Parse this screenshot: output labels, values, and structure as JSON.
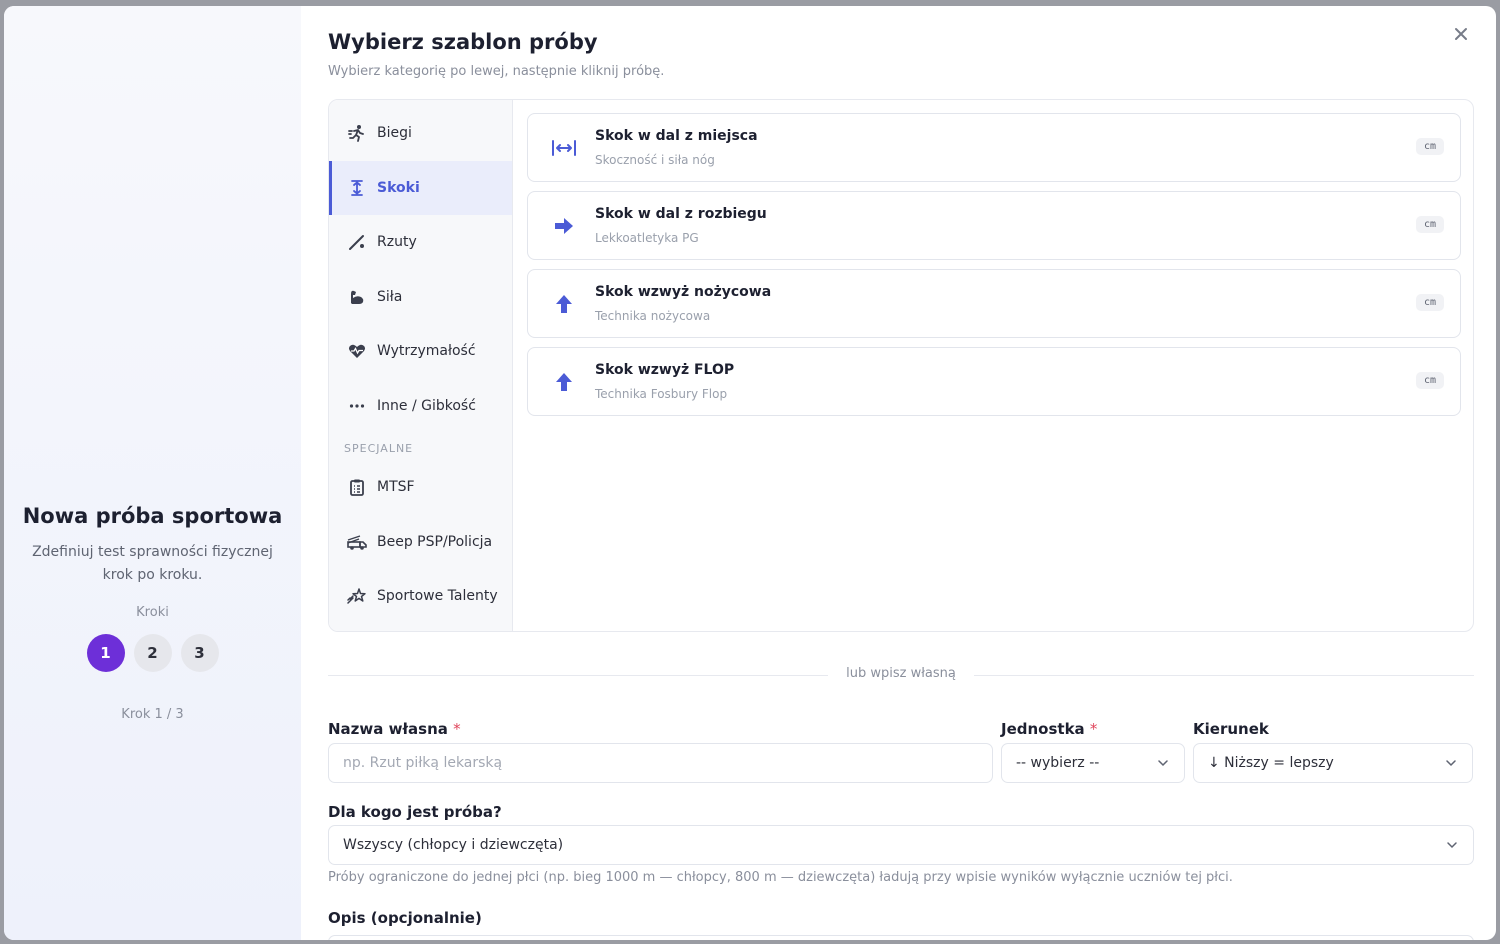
{
  "wizard": {
    "title": "Nowa próba sportowa",
    "subtitle": "Zdefiniuj test sprawności fizycznej krok po kroku.",
    "steps_label": "Kroki",
    "steps": [
      "1",
      "2",
      "3"
    ],
    "active_step": "1",
    "counter": "Krok 1 / 3"
  },
  "header": {
    "title": "Wybierz szablon próby",
    "subtitle": "Wybierz kategorię po lewej, następnie kliknij próbę.",
    "close_icon": "close-icon"
  },
  "categories": [
    {
      "label": "Biegi",
      "icon": "running-icon"
    },
    {
      "label": "Skoki",
      "icon": "vertical-height-icon",
      "active": true
    },
    {
      "label": "Rzuty",
      "icon": "javelin-icon"
    },
    {
      "label": "Siła",
      "icon": "flexed-arm-icon"
    },
    {
      "label": "Wytrzymałość",
      "icon": "heart-pulse-icon"
    },
    {
      "label": "Inne / Gibkość",
      "icon": "more-dots-icon"
    }
  ],
  "special_section": "SPECJALNE",
  "special_categories": [
    {
      "label": "MTSF",
      "icon": "clipboard-list-icon"
    },
    {
      "label": "Beep PSP/Policja",
      "icon": "fire-truck-icon"
    },
    {
      "label": "Sportowe Talenty",
      "icon": "star-trail-icon"
    }
  ],
  "templates": [
    {
      "name": "Skok w dal z miejsca",
      "desc": "Skoczność i siła nóg",
      "unit": "cm",
      "icon": "horizontal-distance-icon"
    },
    {
      "name": "Skok w dal z rozbiegu",
      "desc": "Lekkoatletyka PG",
      "unit": "cm",
      "icon": "arrow-right-icon"
    },
    {
      "name": "Skok wzwyż nożycowa",
      "desc": "Technika nożycowa",
      "unit": "cm",
      "icon": "arrow-up-icon"
    },
    {
      "name": "Skok wzwyż FLOP",
      "desc": "Technika Fosbury Flop",
      "unit": "cm",
      "icon": "arrow-up-icon"
    }
  ],
  "divider_text": "lub wpisz własną",
  "form": {
    "name_label": "Nazwa własna",
    "name_required": "*",
    "name_placeholder": "np. Rzut piłką lekarską",
    "unit_label": "Jednostka",
    "unit_required": "*",
    "unit_value": "-- wybierz --",
    "direction_label": "Kierunek",
    "direction_value": "↓ Niższy = lepszy",
    "audience_label": "Dla kogo jest próba?",
    "audience_value": "Wszyscy (chłopcy i dziewczęta)",
    "audience_hint": "Próby ograniczone do jednej płci (np. bieg 1000 m — chłopcy, 800 m — dziewczęta) ładują przy wpisie wyników wyłącznie uczniów tej płci.",
    "description_label": "Opis (opcjonalnie)"
  },
  "colors": {
    "accent": "#4b5bd6",
    "step_active": "#6d2fd8",
    "required": "#e0455b"
  }
}
